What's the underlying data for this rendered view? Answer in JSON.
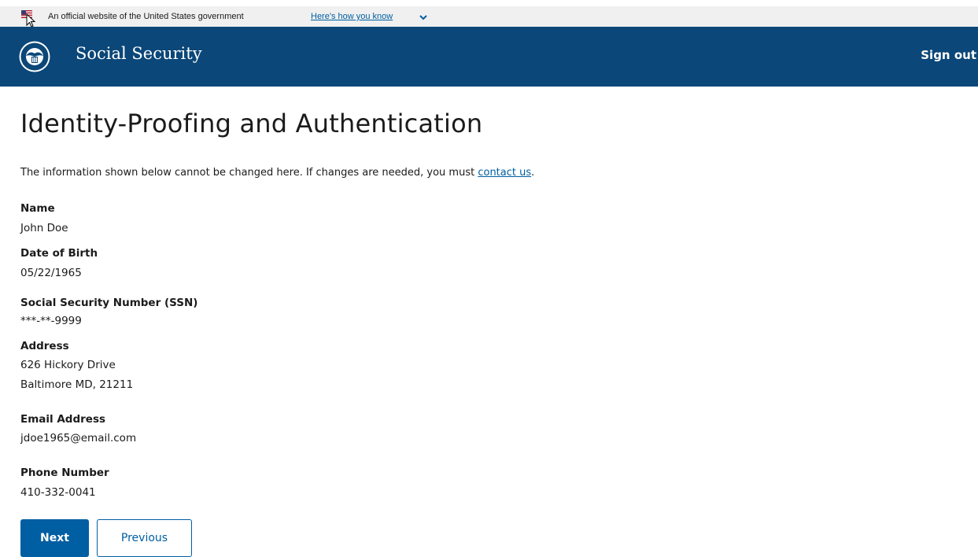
{
  "banner": {
    "text": "An official website of the United States government",
    "link_text": "Here's how you know"
  },
  "header": {
    "site_title": "Social Security",
    "sign_out": "Sign out"
  },
  "main": {
    "title": "Identity-Proofing and Authentication",
    "intro_text": "The information shown below cannot be changed here. If changes are needed, you must ",
    "intro_link": "contact us",
    "intro_end": ".",
    "fields": {
      "name_label": "Name",
      "name_value": "John Doe",
      "dob_label": "Date of Birth",
      "dob_value": "05/22/1965",
      "ssn_label": "Social Security Number (SSN)",
      "ssn_value": "***-**-9999",
      "address_label": "Address",
      "address_line1": "626 Hickory Drive",
      "address_line2": "Baltimore MD, 21211",
      "email_label": "Email Address",
      "email_value": "jdoe1965@email.com",
      "phone_label": "Phone Number",
      "phone_value": "410-332-0041"
    },
    "buttons": {
      "next": "Next",
      "previous": "Previous"
    }
  },
  "colors": {
    "header_bg": "#0b4778",
    "banner_bg": "#f0f0f0",
    "primary": "#005ea2",
    "text": "#1b1b1b"
  }
}
